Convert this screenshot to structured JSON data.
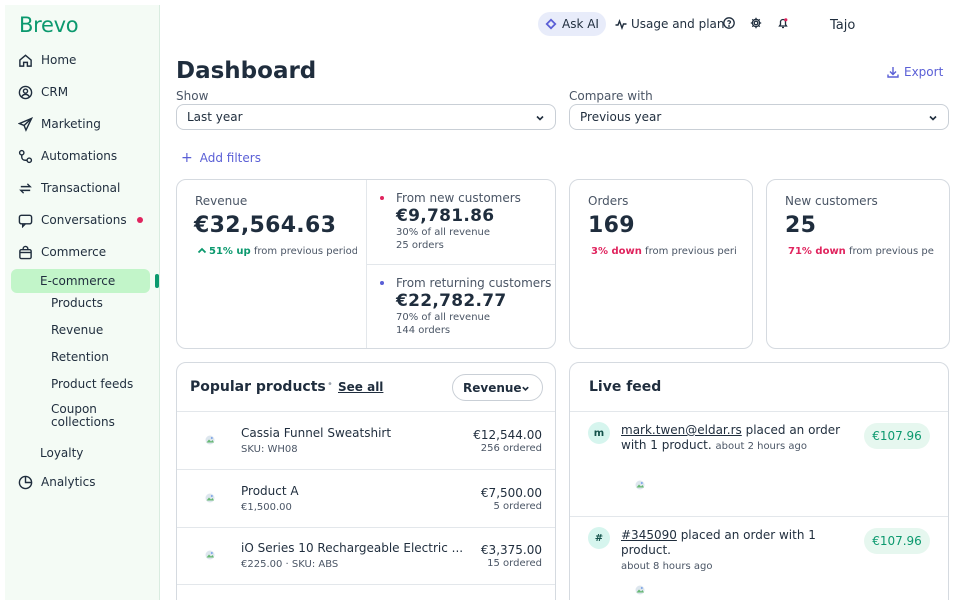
{
  "app": {
    "logo": "Brevo"
  },
  "sidebar": {
    "items": [
      {
        "label": "Home",
        "icon": "home-icon"
      },
      {
        "label": "CRM",
        "icon": "contacts-icon"
      },
      {
        "label": "Marketing",
        "icon": "send-icon"
      },
      {
        "label": "Automations",
        "icon": "automation-icon"
      },
      {
        "label": "Transactional",
        "icon": "transactional-icon"
      },
      {
        "label": "Conversations",
        "icon": "chat-icon",
        "has_notification_dot": true
      },
      {
        "label": "Commerce",
        "icon": "shopping-bag-icon"
      }
    ],
    "active_item": "E-commerce",
    "sub_items": [
      "Products",
      "Revenue",
      "Retention",
      "Product feeds",
      "Coupon collections"
    ],
    "bottom_items": [
      {
        "label": "Loyalty"
      },
      {
        "label": "Analytics",
        "icon": "pie-chart-icon"
      }
    ]
  },
  "topbar": {
    "ask_ai": "Ask AI",
    "usage": "Usage and plan",
    "username": "Tajo"
  },
  "header": {
    "title": "Dashboard",
    "export": "Export",
    "show_label": "Show",
    "show_value": "Last year",
    "compare_label": "Compare with",
    "compare_value": "Previous year",
    "add_filters": "Add filters"
  },
  "kpis": {
    "revenue": {
      "label": "Revenue",
      "value": "€32,564.63",
      "trend": "51% up",
      "trend_suffix": "from previous period"
    },
    "new_customers_revenue": {
      "label": "From new customers",
      "value": "€9,781.86",
      "share": "30% of all revenue",
      "orders": "25 orders"
    },
    "returning_customers_revenue": {
      "label": "From returning customers",
      "value": "€22,782.77",
      "share": "70% of all revenue",
      "orders": "144 orders"
    },
    "orders": {
      "label": "Orders",
      "value": "169",
      "trend": "3% down",
      "trend_suffix": "from previous perio"
    },
    "new_customers": {
      "label": "New customers",
      "value": "25",
      "trend": "71% down",
      "trend_suffix": "from previous peri"
    }
  },
  "popular_products": {
    "title": "Popular products",
    "see_all": "See all",
    "sort": "Revenue",
    "items": [
      {
        "name": "Cassia Funnel Sweatshirt",
        "sub": "SKU: WH08",
        "amount": "€12,544.00",
        "qty": "256 ordered"
      },
      {
        "name": "Product A",
        "sub": "€1,500.00",
        "amount": "€7,500.00",
        "qty": "5 ordered"
      },
      {
        "name": "iO Series 10 Rechargeable Electric ...",
        "sub": "€225.00 · SKU: ABS",
        "amount": "€3,375.00",
        "qty": "15 ordered"
      }
    ]
  },
  "live_feed": {
    "title": "Live feed",
    "items": [
      {
        "avatar": "m",
        "link": "mark.twen@eldar.rs",
        "text": " placed an order with 1 product.",
        "time": "about 2 hours ago",
        "amount": "€107.96"
      },
      {
        "avatar": "#",
        "link": "#345090",
        "text": " placed an order with 1 product.",
        "time": "about 8 hours ago",
        "amount": "€107.96"
      }
    ]
  },
  "colors": {
    "brand": "#0b996e",
    "accent": "#5a5fd6",
    "up": "#0b996e",
    "down": "#e0245e",
    "active_nav_bg": "#c2f5c9",
    "sidebar_bg": "#f4fbf5"
  }
}
